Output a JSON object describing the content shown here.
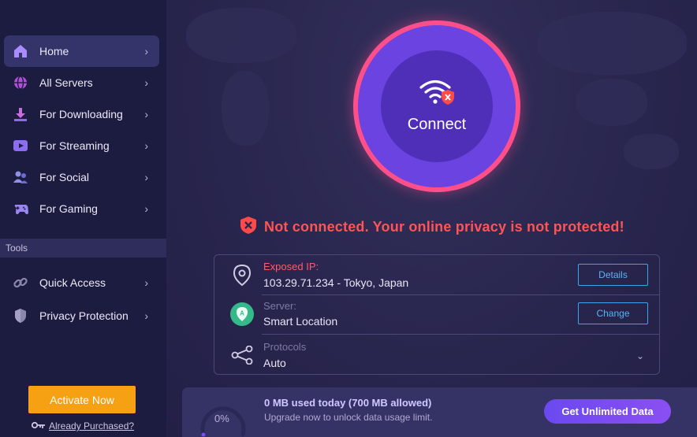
{
  "sidebar": {
    "items": [
      {
        "label": "Home",
        "icon": "home-icon"
      },
      {
        "label": "All Servers",
        "icon": "globe-icon"
      },
      {
        "label": "For Downloading",
        "icon": "download-icon"
      },
      {
        "label": "For Streaming",
        "icon": "play-icon"
      },
      {
        "label": "For Social",
        "icon": "people-icon"
      },
      {
        "label": "For Gaming",
        "icon": "gamepad-icon"
      }
    ],
    "tools_header": "Tools",
    "tools": [
      {
        "label": "Quick Access",
        "icon": "link-icon"
      },
      {
        "label": "Privacy Protection",
        "icon": "shield-icon"
      }
    ],
    "activate_label": "Activate Now",
    "purchased_label": "Already Purchased?"
  },
  "connect": {
    "label": "Connect",
    "status": "Not connected. Your online privacy is not protected!"
  },
  "info": {
    "ip_label": "Exposed IP:",
    "ip_value": "103.29.71.234 - Tokyo, Japan",
    "details_label": "Details",
    "server_label": "Server:",
    "server_value": "Smart Location",
    "change_label": "Change",
    "protocols_label": "Protocols",
    "protocols_value": "Auto"
  },
  "usage": {
    "percent_label": "0%",
    "percent_value": 0,
    "title": "0 MB used today (700 MB allowed)",
    "subtitle": "Upgrade now to unlock data usage limit.",
    "button_label": "Get Unlimited Data"
  },
  "colors": {
    "accent_purple": "#7b4ef0",
    "ring_pink": "#ff4f8a",
    "warning_red": "#ff5454",
    "activate_orange": "#f6a013",
    "link_blue": "#3da5ee"
  }
}
